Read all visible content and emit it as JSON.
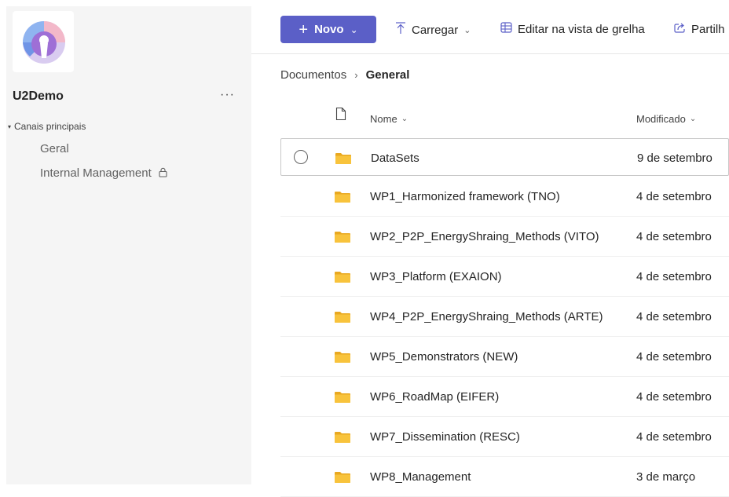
{
  "sidebar": {
    "team_name": "U2Demo",
    "more_label": "···",
    "section_label": "Canais principais",
    "section_caret": "▾",
    "channels": [
      {
        "label": "Geral",
        "private": false
      },
      {
        "label": "Internal Management",
        "private": true
      }
    ]
  },
  "toolbar": {
    "new_label": "Novo",
    "new_icon": "+",
    "new_chevron": "⌄",
    "upload_label": "Carregar",
    "upload_icon": "⤒",
    "upload_chevron": "⌄",
    "grid_label": "Editar na vista de grelha",
    "grid_icon": "⊞",
    "share_label": "Partilh",
    "share_icon": "⇪"
  },
  "breadcrumb": {
    "parent": "Documentos",
    "separator": "›",
    "current": "General"
  },
  "columns": {
    "name": "Nome",
    "modified": "Modificado",
    "sort_chevron": "⌄"
  },
  "files": [
    {
      "name": "DataSets",
      "modified": "9 de setembro",
      "selected": true
    },
    {
      "name": "WP1_Harmonized framework (TNO)",
      "modified": "4 de setembro"
    },
    {
      "name": "WP2_P2P_EnergyShraing_Methods (VITO)",
      "modified": "4 de setembro"
    },
    {
      "name": "WP3_Platform (EXAION)",
      "modified": "4 de setembro"
    },
    {
      "name": "WP4_P2P_EnergyShraing_Methods (ARTE)",
      "modified": "4 de setembro"
    },
    {
      "name": "WP5_Demonstrators (NEW)",
      "modified": "4 de setembro"
    },
    {
      "name": "WP6_RoadMap (EIFER)",
      "modified": "4 de setembro"
    },
    {
      "name": "WP7_Dissemination (RESC)",
      "modified": "4 de setembro"
    },
    {
      "name": "WP8_Management",
      "modified": "3 de março"
    }
  ],
  "colors": {
    "accent": "#5b5fc7",
    "folder": "#f8c33c",
    "sidebar_bg": "#f5f5f5"
  }
}
